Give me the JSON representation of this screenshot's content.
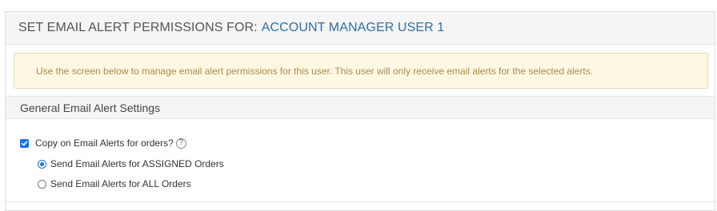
{
  "header": {
    "prefix": "SET EMAIL ALERT PERMISSIONS FOR:",
    "user_name": "ACCOUNT MANAGER USER 1"
  },
  "notice": {
    "text": "Use the screen below to manage email alert permissions for this user. This user will only receive email alerts for the selected alerts."
  },
  "section": {
    "title": "General Email Alert Settings"
  },
  "settings": {
    "copy_checkbox": {
      "label": "Copy on Email Alerts for orders?",
      "checked": true,
      "help_icon": "?"
    },
    "options": [
      {
        "label": "Send Email Alerts for ASSIGNED Orders",
        "selected": true
      },
      {
        "label": "Send Email Alerts for ALL Orders",
        "selected": false
      }
    ]
  },
  "colors": {
    "accent": "#1a73e8",
    "user_link": "#2f6fa3",
    "notice_bg": "#fcf8e3",
    "notice_text": "#b0894b"
  }
}
